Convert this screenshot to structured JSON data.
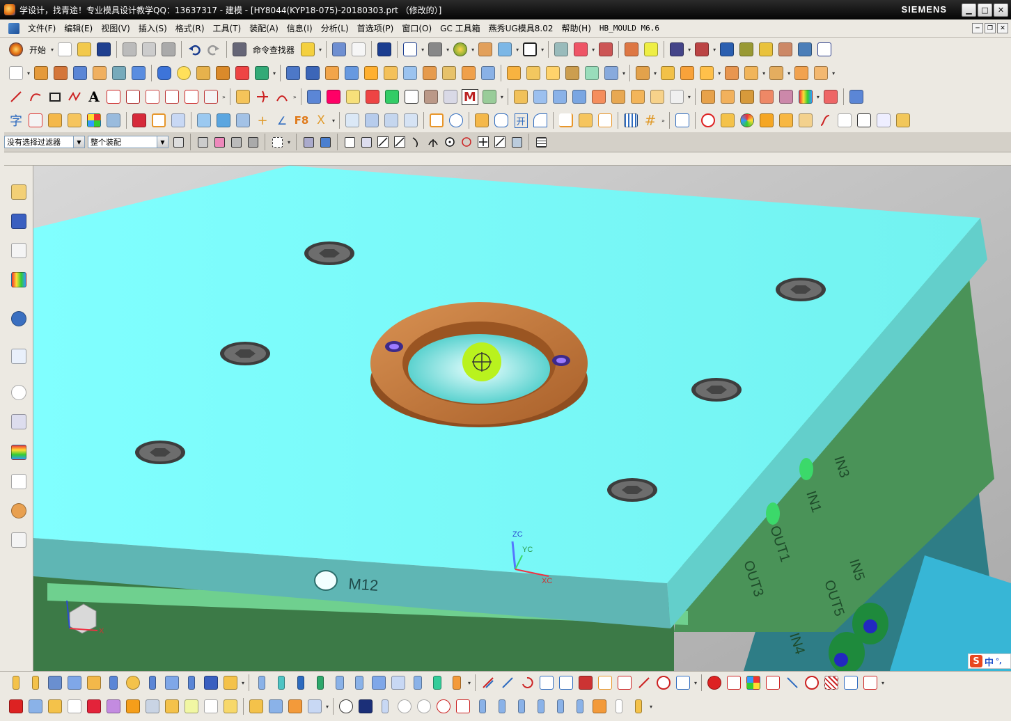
{
  "titlebar": {
    "title": "学设计，找青途！专业模具设计教学QQ：13637317 - 建模 - [HY8044(KYP18-075)-20180303.prt （修改的）]",
    "brand": "SIEMENS",
    "minimize": "▁",
    "maximize": "□",
    "close": "✕"
  },
  "menubar": {
    "items": [
      "文件(F)",
      "编辑(E)",
      "视图(V)",
      "插入(S)",
      "格式(R)",
      "工具(T)",
      "装配(A)",
      "信息(I)",
      "分析(L)",
      "首选项(P)",
      "窗口(O)",
      "GC 工具箱",
      "燕秀UG模具8.02",
      "帮助(H)",
      "HB_MOULD M6.6"
    ],
    "mdi": [
      "─",
      "❐",
      "✕"
    ]
  },
  "toolbar1": {
    "start_label": "开始",
    "finder_label": "命令查找器"
  },
  "filterbar": {
    "selection_filter": "没有选择过滤器",
    "assembly_scope": "整个装配"
  },
  "model": {
    "plate_label": "M12",
    "side_labels": [
      "IN3",
      "IN1",
      "OUT1",
      "OUT3",
      "IN5",
      "OUT5",
      "IN4"
    ],
    "axis_labels": {
      "zc": "ZC",
      "yc": "YC",
      "xc": "XC",
      "x": "X"
    }
  },
  "ime": {
    "label": "中",
    "extra": "°,"
  },
  "colors": {
    "plate_top": "#7effff",
    "plate_front": "#5fb6b4",
    "plate_right": "#63cfcb",
    "mid_green": "#3f8a50",
    "locating_ring": "#c27a3f",
    "viewport_bg": "#c4c4c4"
  }
}
